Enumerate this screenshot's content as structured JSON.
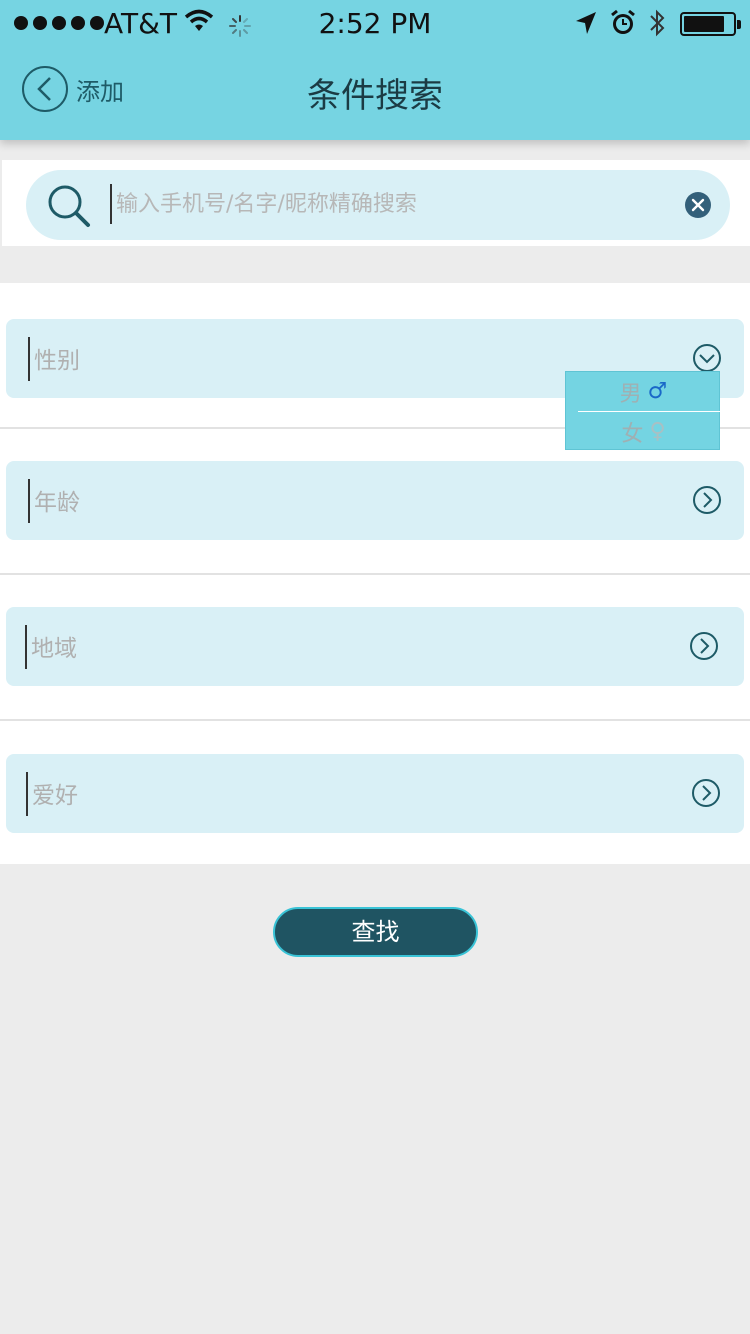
{
  "status_bar": {
    "carrier": "AT&T",
    "time": "2:52 PM"
  },
  "nav": {
    "back_label": "添加",
    "title": "条件搜索"
  },
  "search": {
    "placeholder": "输入手机号/名字/昵称精确搜索",
    "value": ""
  },
  "filters": {
    "gender": {
      "label": "性别",
      "icon": "chevron-down-circle-icon"
    },
    "age": {
      "label": "年龄",
      "icon": "chevron-right-circle-icon"
    },
    "region": {
      "label": "地域",
      "icon": "chevron-right-circle-icon"
    },
    "hobby": {
      "label": "爱好",
      "icon": "chevron-right-circle-icon"
    }
  },
  "gender_dropdown": {
    "male": "男",
    "female": "女",
    "male_symbol": "♂",
    "female_symbol": "♀"
  },
  "find_button": "查找",
  "colors": {
    "header": "#76d4e2",
    "field_bg": "#d9f0f6",
    "button_bg": "#1f5462",
    "accent_dark": "#1e5b67"
  }
}
